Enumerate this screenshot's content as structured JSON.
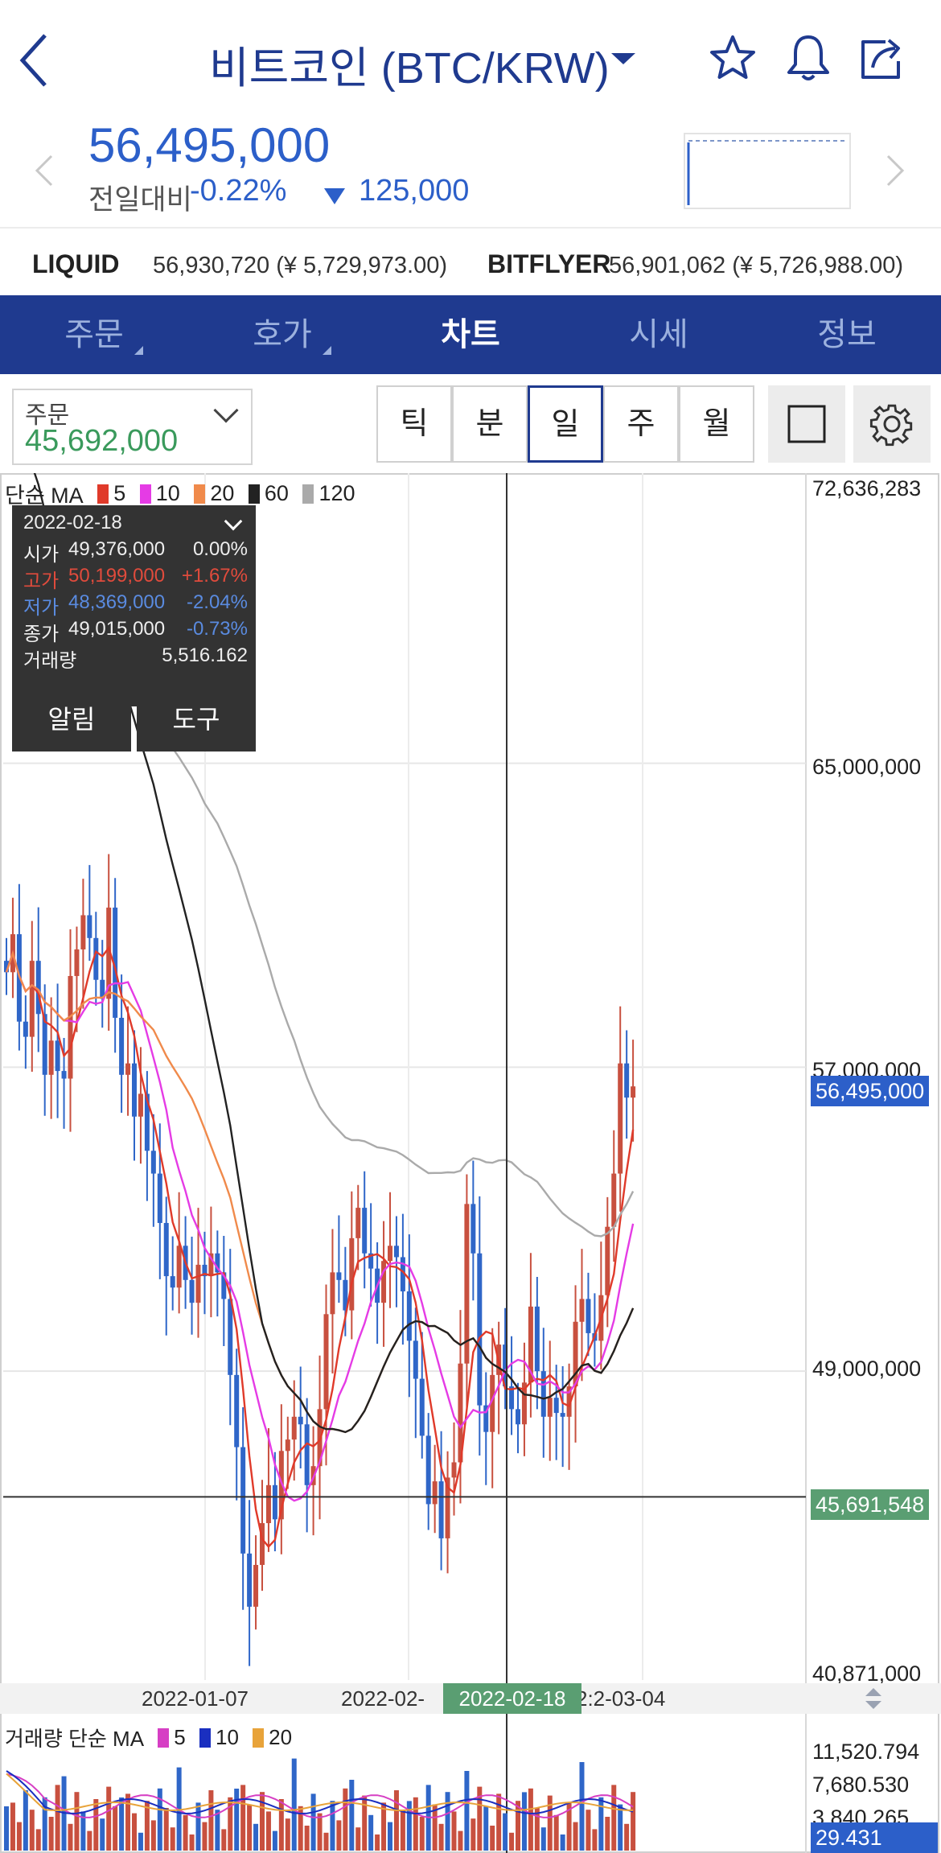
{
  "header": {
    "title": "비트코인 (BTC/KRW)",
    "icons": [
      "back-icon",
      "caret-down-icon",
      "star-icon",
      "bell-icon",
      "share-icon"
    ]
  },
  "price": {
    "current": "56,495,000",
    "change_label": "전일대비",
    "change_pct": "-0.22%",
    "change_abs": "125,000",
    "color": "#2c5fc9"
  },
  "exchanges": [
    {
      "name": "LIQUID",
      "value": "56,930,720 (¥ 5,729,973.00)"
    },
    {
      "name": "BITFLYER",
      "value": "56,901,062 (¥ 5,726,988.00)"
    }
  ],
  "tabs": [
    {
      "label": "주문",
      "active": false
    },
    {
      "label": "호가",
      "active": false
    },
    {
      "label": "차트",
      "active": true
    },
    {
      "label": "시세",
      "active": false
    },
    {
      "label": "정보",
      "active": false
    }
  ],
  "toolbar": {
    "order_label": "주문",
    "order_value": "45,692,000",
    "periods": [
      "틱",
      "분",
      "일",
      "주",
      "월"
    ],
    "active_period": "일"
  },
  "ma_legend": {
    "label": "단순 MA",
    "items": [
      {
        "label": "5",
        "color": "#e03a2a"
      },
      {
        "label": "10",
        "color": "#e53be5"
      },
      {
        "label": "20",
        "color": "#f08a4b"
      },
      {
        "label": "60",
        "color": "#222222"
      },
      {
        "label": "120",
        "color": "#aaaaaa"
      }
    ]
  },
  "tooltip": {
    "date": "2022-02-18",
    "rows": [
      {
        "label": "시가",
        "value": "49,376,000",
        "pct": "0.00%",
        "color": "#eeeeee"
      },
      {
        "label": "고가",
        "value": "50,199,000",
        "pct": "+1.67%",
        "color": "#e04b3c"
      },
      {
        "label": "저가",
        "value": "48,369,000",
        "pct": "-2.04%",
        "color": "#5a8be0"
      },
      {
        "label": "종가",
        "value": "49,015,000",
        "pct": "-0.73%",
        "color": "#eeeeee"
      }
    ],
    "volume_label": "거래량",
    "volume_value": "5,516.162",
    "alert_button": "알림",
    "tool_button": "도구"
  },
  "price_axis": {
    "labels": [
      "72,636,283",
      "65,000,000",
      "57,000,000",
      "49,000,000",
      "40,871,000"
    ],
    "current_badge": "56,495,000",
    "cross_badge": "45,691,548"
  },
  "x_axis": {
    "labels": [
      "2022-01-07",
      "2022-02-",
      "2:2-03-04"
    ],
    "cross_badge": "2022-02-18"
  },
  "volume": {
    "legend_label": "거래량 단순 MA",
    "items": [
      {
        "label": "5",
        "color": "#d63fc4"
      },
      {
        "label": "10",
        "color": "#1a2fc0"
      },
      {
        "label": "20",
        "color": "#e8a33a"
      }
    ],
    "axis_labels": [
      "11,520.794",
      "7,680.530",
      "3,840.265"
    ],
    "current_badge": "29.431"
  },
  "chart_data": {
    "type": "candlestick",
    "title": "",
    "ylim": [
      40871000,
      72636283
    ],
    "x_ticks": [
      "2022-01-07",
      "2022-02-",
      "2022-02-18",
      "2022-03-04"
    ],
    "selected": {
      "date": "2022-02-18",
      "open": 49376000,
      "high": 50199000,
      "low": 48369000,
      "close": 49015000,
      "volume": 5516.162
    },
    "last_close": 56495000,
    "cross_price": 45691548,
    "closes": [
      59500000,
      60500000,
      58200000,
      57800000,
      59800000,
      58400000,
      56800000,
      57700000,
      56900000,
      56700000,
      59400000,
      60100000,
      61000000,
      60400000,
      59300000,
      58800000,
      61200000,
      58300000,
      56800000,
      57100000,
      55700000,
      56300000,
      54800000,
      54200000,
      52900000,
      51500000,
      51200000,
      52300000,
      51400000,
      50800000,
      51800000,
      51500000,
      52100000,
      51600000,
      50900000,
      48900000,
      47000000,
      44200000,
      42800000,
      43900000,
      45000000,
      46000000,
      45100000,
      46900000,
      47200000,
      47800000,
      47600000,
      46000000,
      46500000,
      48000000,
      50500000,
      51600000,
      51400000,
      50600000,
      52500000,
      53300000,
      52100000,
      51700000,
      50800000,
      51900000,
      52300000,
      52000000,
      51100000,
      49800000,
      48800000,
      47300000,
      45500000,
      46100000,
      44600000,
      46200000,
      46600000,
      49200000,
      53400000,
      52100000,
      48100000,
      47400000,
      48900000,
      49700000,
      48600000,
      48000000,
      47600000,
      48700000,
      50700000,
      49000000,
      47800000,
      48300000,
      47900000,
      47800000,
      48600000,
      50300000,
      50900000,
      50000000,
      49800000,
      51000000,
      52800000,
      54200000,
      57100000,
      56200000,
      56495000
    ],
    "ma_periods": [
      5,
      10,
      20,
      60,
      120
    ]
  }
}
